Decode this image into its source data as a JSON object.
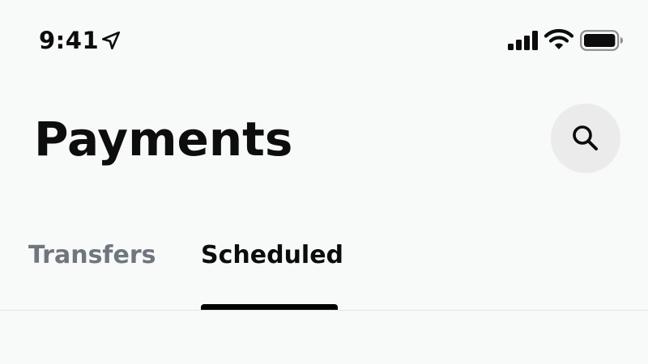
{
  "status_bar": {
    "time": "9:41",
    "icons": {
      "location": "location-arrow-icon",
      "signal": "cellular-signal-icon",
      "wifi": "wifi-icon",
      "battery": "battery-full-icon"
    }
  },
  "header": {
    "title": "Payments",
    "search_icon": "search-icon"
  },
  "tabs": [
    {
      "label": "Transfers",
      "active": false
    },
    {
      "label": "Scheduled",
      "active": true
    }
  ],
  "colors": {
    "background": "#f8f9f9",
    "text_primary": "#0c0c0c",
    "tab_inactive": "#6f767d",
    "tab_indicator": "#000000",
    "search_button_bg": "#ebebec",
    "divider": "#e2e4e6"
  }
}
